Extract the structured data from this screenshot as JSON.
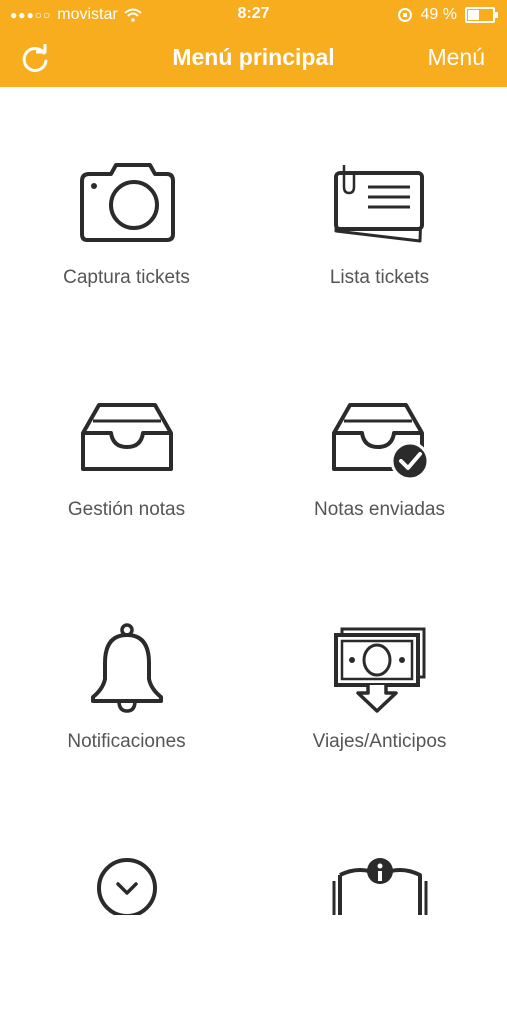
{
  "status_bar": {
    "signal_dots": "●●●○○",
    "carrier": "movistar",
    "time": "8:27",
    "battery_percent": "49 %"
  },
  "navbar": {
    "title": "Menú principal",
    "menu_label": "Menú"
  },
  "menu_items": [
    {
      "label": "Captura tickets",
      "icon": "camera-icon"
    },
    {
      "label": "Lista tickets",
      "icon": "ticket-list-icon"
    },
    {
      "label": "Gestión notas",
      "icon": "inbox-tray-icon"
    },
    {
      "label": "Notas enviadas",
      "icon": "inbox-check-icon"
    },
    {
      "label": "Notificaciones",
      "icon": "bell-icon"
    },
    {
      "label": "Viajes/Anticipos",
      "icon": "money-download-icon"
    },
    {
      "label": "",
      "icon": "chevron-circle-icon"
    },
    {
      "label": "",
      "icon": "info-book-icon"
    }
  ],
  "colors": {
    "header": "#f8ad1f",
    "icon_stroke": "#2b2b2b",
    "label": "#555555"
  }
}
